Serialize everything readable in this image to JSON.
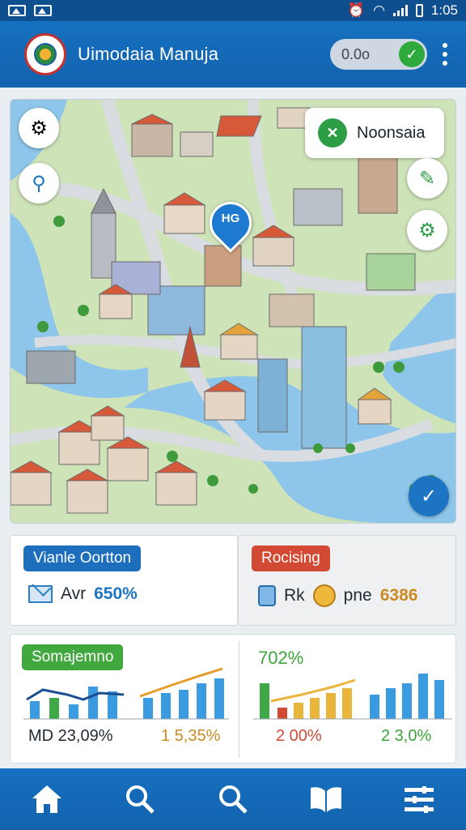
{
  "status_bar": {
    "time": "1:05"
  },
  "app_bar": {
    "title": "Uimodaia Manuja",
    "toggle_label": "0.0o"
  },
  "map": {
    "chip_label": "Noonsaia",
    "pin_label": "HG"
  },
  "card_left": {
    "badge": "Vianle Oortton",
    "metric_label": "Avr",
    "metric_value": "650%"
  },
  "card_right": {
    "badge": "Rocising",
    "metric_label_1": "Rk",
    "metric_label_2": "pne",
    "metric_value": "6386"
  },
  "card_bottom": {
    "badge": "Somajemno",
    "headline_pct": "702%",
    "left_footer_1": "MD 23,09%",
    "left_footer_2": "1 5,35%",
    "right_footer_1": "2 00%",
    "right_footer_2": "2 3,0%"
  },
  "bottom_nav": {
    "items": [
      "home",
      "search",
      "search",
      "book",
      "menu"
    ]
  },
  "colors": {
    "primary": "#1670c0",
    "accent_green": "#40a83e",
    "accent_red": "#d24a33",
    "accent_orange": "#c98a22",
    "water": "#8dc6ea"
  }
}
